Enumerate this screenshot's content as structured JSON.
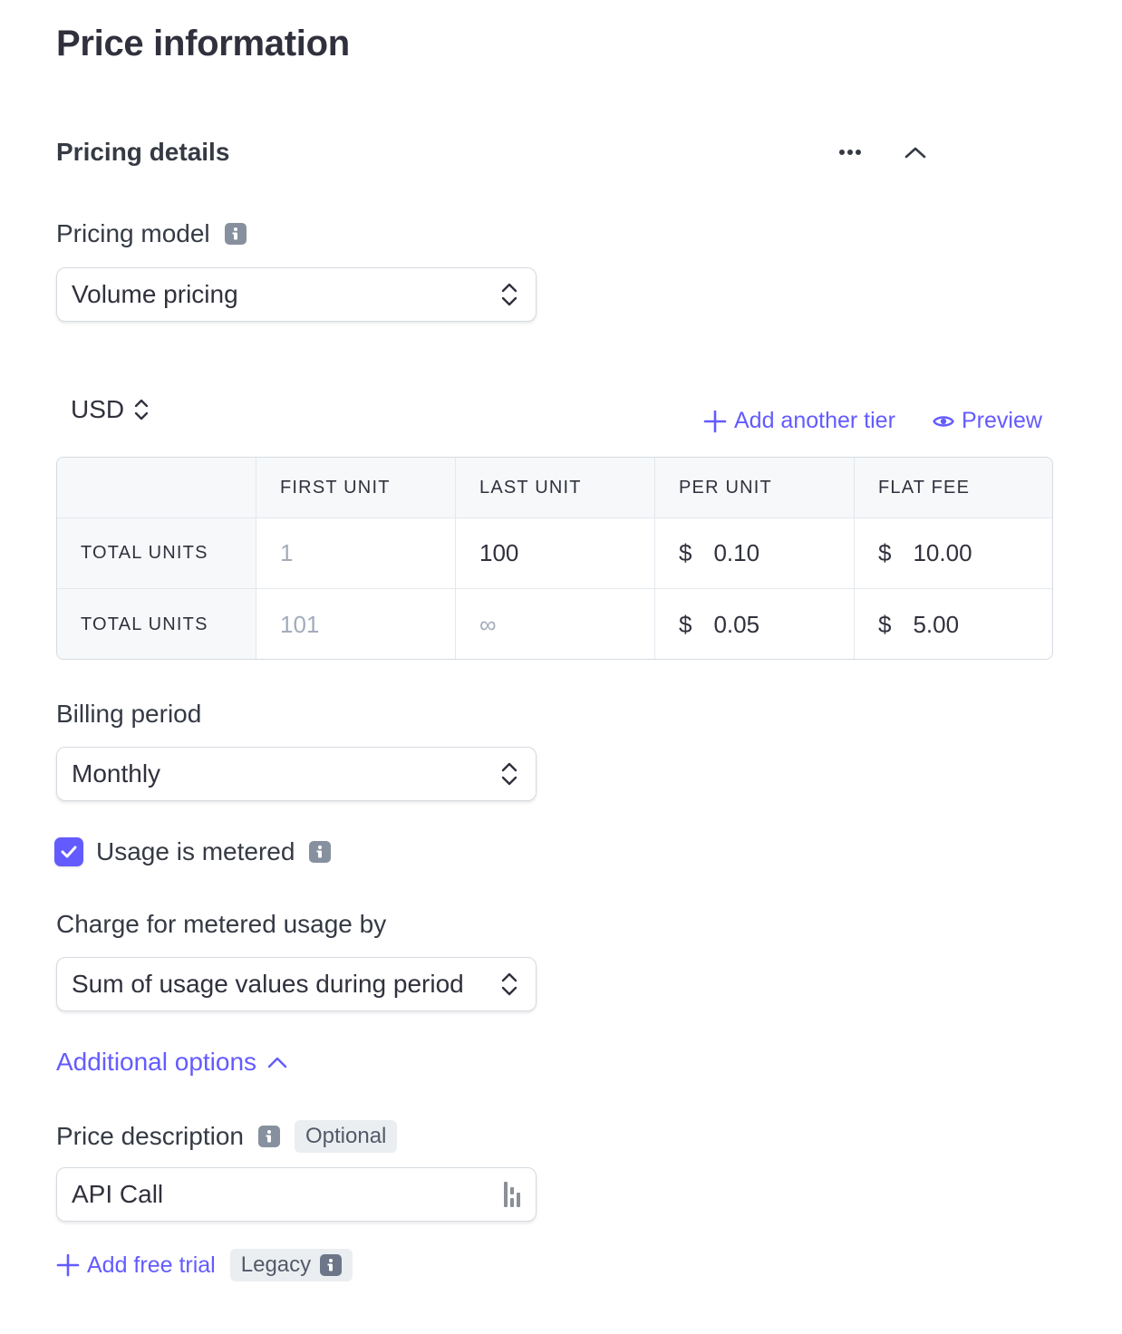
{
  "page": {
    "title": "Price information"
  },
  "pricing_details": {
    "title": "Pricing details",
    "more_icon": "more-horizontal-icon",
    "collapse_icon": "chevron-up-icon"
  },
  "pricing_model": {
    "label": "Pricing model",
    "value": "Volume pricing"
  },
  "currency": {
    "value": "USD"
  },
  "actions": {
    "add_tier": "Add another tier",
    "preview": "Preview"
  },
  "tier_table": {
    "columns": [
      "",
      "FIRST UNIT",
      "LAST UNIT",
      "PER UNIT",
      "FLAT FEE"
    ],
    "rows": [
      {
        "label": "TOTAL UNITS",
        "first_unit": "1",
        "last_unit": "100",
        "per_unit_symbol": "$",
        "per_unit": "0.10",
        "flat_fee_symbol": "$",
        "flat_fee": "10.00"
      },
      {
        "label": "TOTAL UNITS",
        "first_unit": "101",
        "last_unit": "∞",
        "per_unit_symbol": "$",
        "per_unit": "0.05",
        "flat_fee_symbol": "$",
        "flat_fee": "5.00"
      }
    ]
  },
  "billing_period": {
    "label": "Billing period",
    "value": "Monthly"
  },
  "usage_metered": {
    "label": "Usage is metered",
    "checked": true
  },
  "charge_metered": {
    "label": "Charge for metered usage by",
    "value": "Sum of usage values during period"
  },
  "additional_options": {
    "label": "Additional options"
  },
  "price_description": {
    "label": "Price description",
    "badge": "Optional",
    "value": "API Call"
  },
  "free_trial": {
    "label": "Add free trial",
    "badge": "Legacy"
  },
  "colors": {
    "accent": "#635bff",
    "text": "#30313d",
    "muted": "#a3acba",
    "border": "#d5dbe1",
    "table_header_bg": "#f6f8fa"
  }
}
